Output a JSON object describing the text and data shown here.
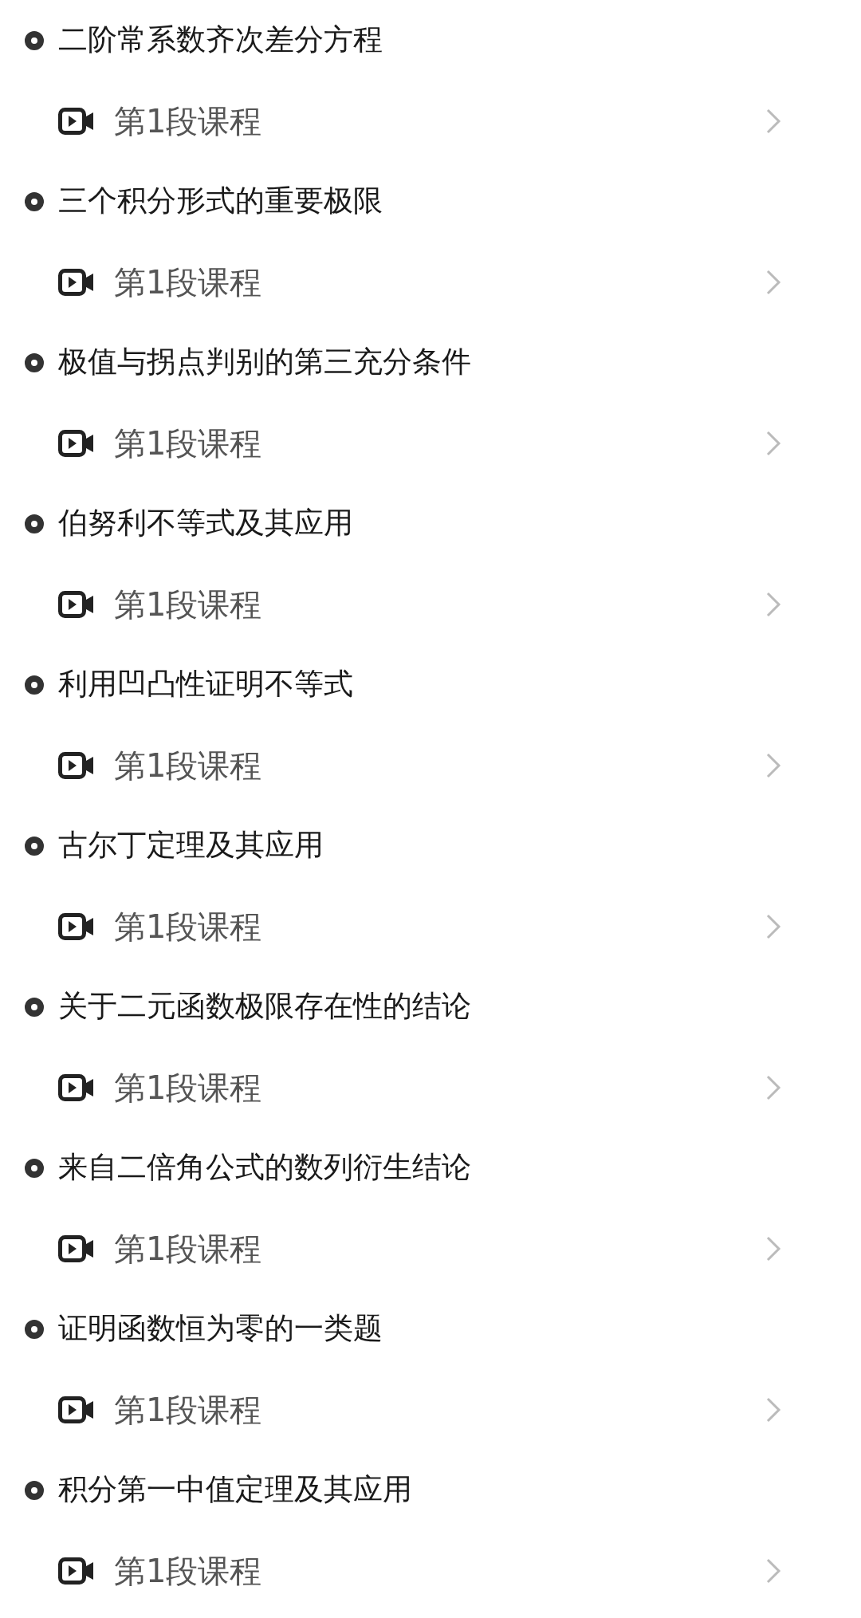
{
  "chapters": [
    {
      "title": "二阶常系数齐次差分方程",
      "lessons": [
        {
          "label": "第1段课程"
        }
      ]
    },
    {
      "title": "三个积分形式的重要极限",
      "lessons": [
        {
          "label": "第1段课程"
        }
      ]
    },
    {
      "title": "极值与拐点判别的第三充分条件",
      "lessons": [
        {
          "label": "第1段课程"
        }
      ]
    },
    {
      "title": "伯努利不等式及其应用",
      "lessons": [
        {
          "label": "第1段课程"
        }
      ]
    },
    {
      "title": "利用凹凸性证明不等式",
      "lessons": [
        {
          "label": "第1段课程"
        }
      ]
    },
    {
      "title": "古尔丁定理及其应用",
      "lessons": [
        {
          "label": "第1段课程"
        }
      ]
    },
    {
      "title": "关于二元函数极限存在性的结论",
      "lessons": [
        {
          "label": "第1段课程"
        }
      ]
    },
    {
      "title": "来自二倍角公式的数列衍生结论",
      "lessons": [
        {
          "label": "第1段课程"
        }
      ]
    },
    {
      "title": "证明函数恒为零的一类题",
      "lessons": [
        {
          "label": "第1段课程"
        }
      ]
    },
    {
      "title": "积分第一中值定理及其应用",
      "lessons": [
        {
          "label": "第1段课程"
        }
      ]
    }
  ]
}
